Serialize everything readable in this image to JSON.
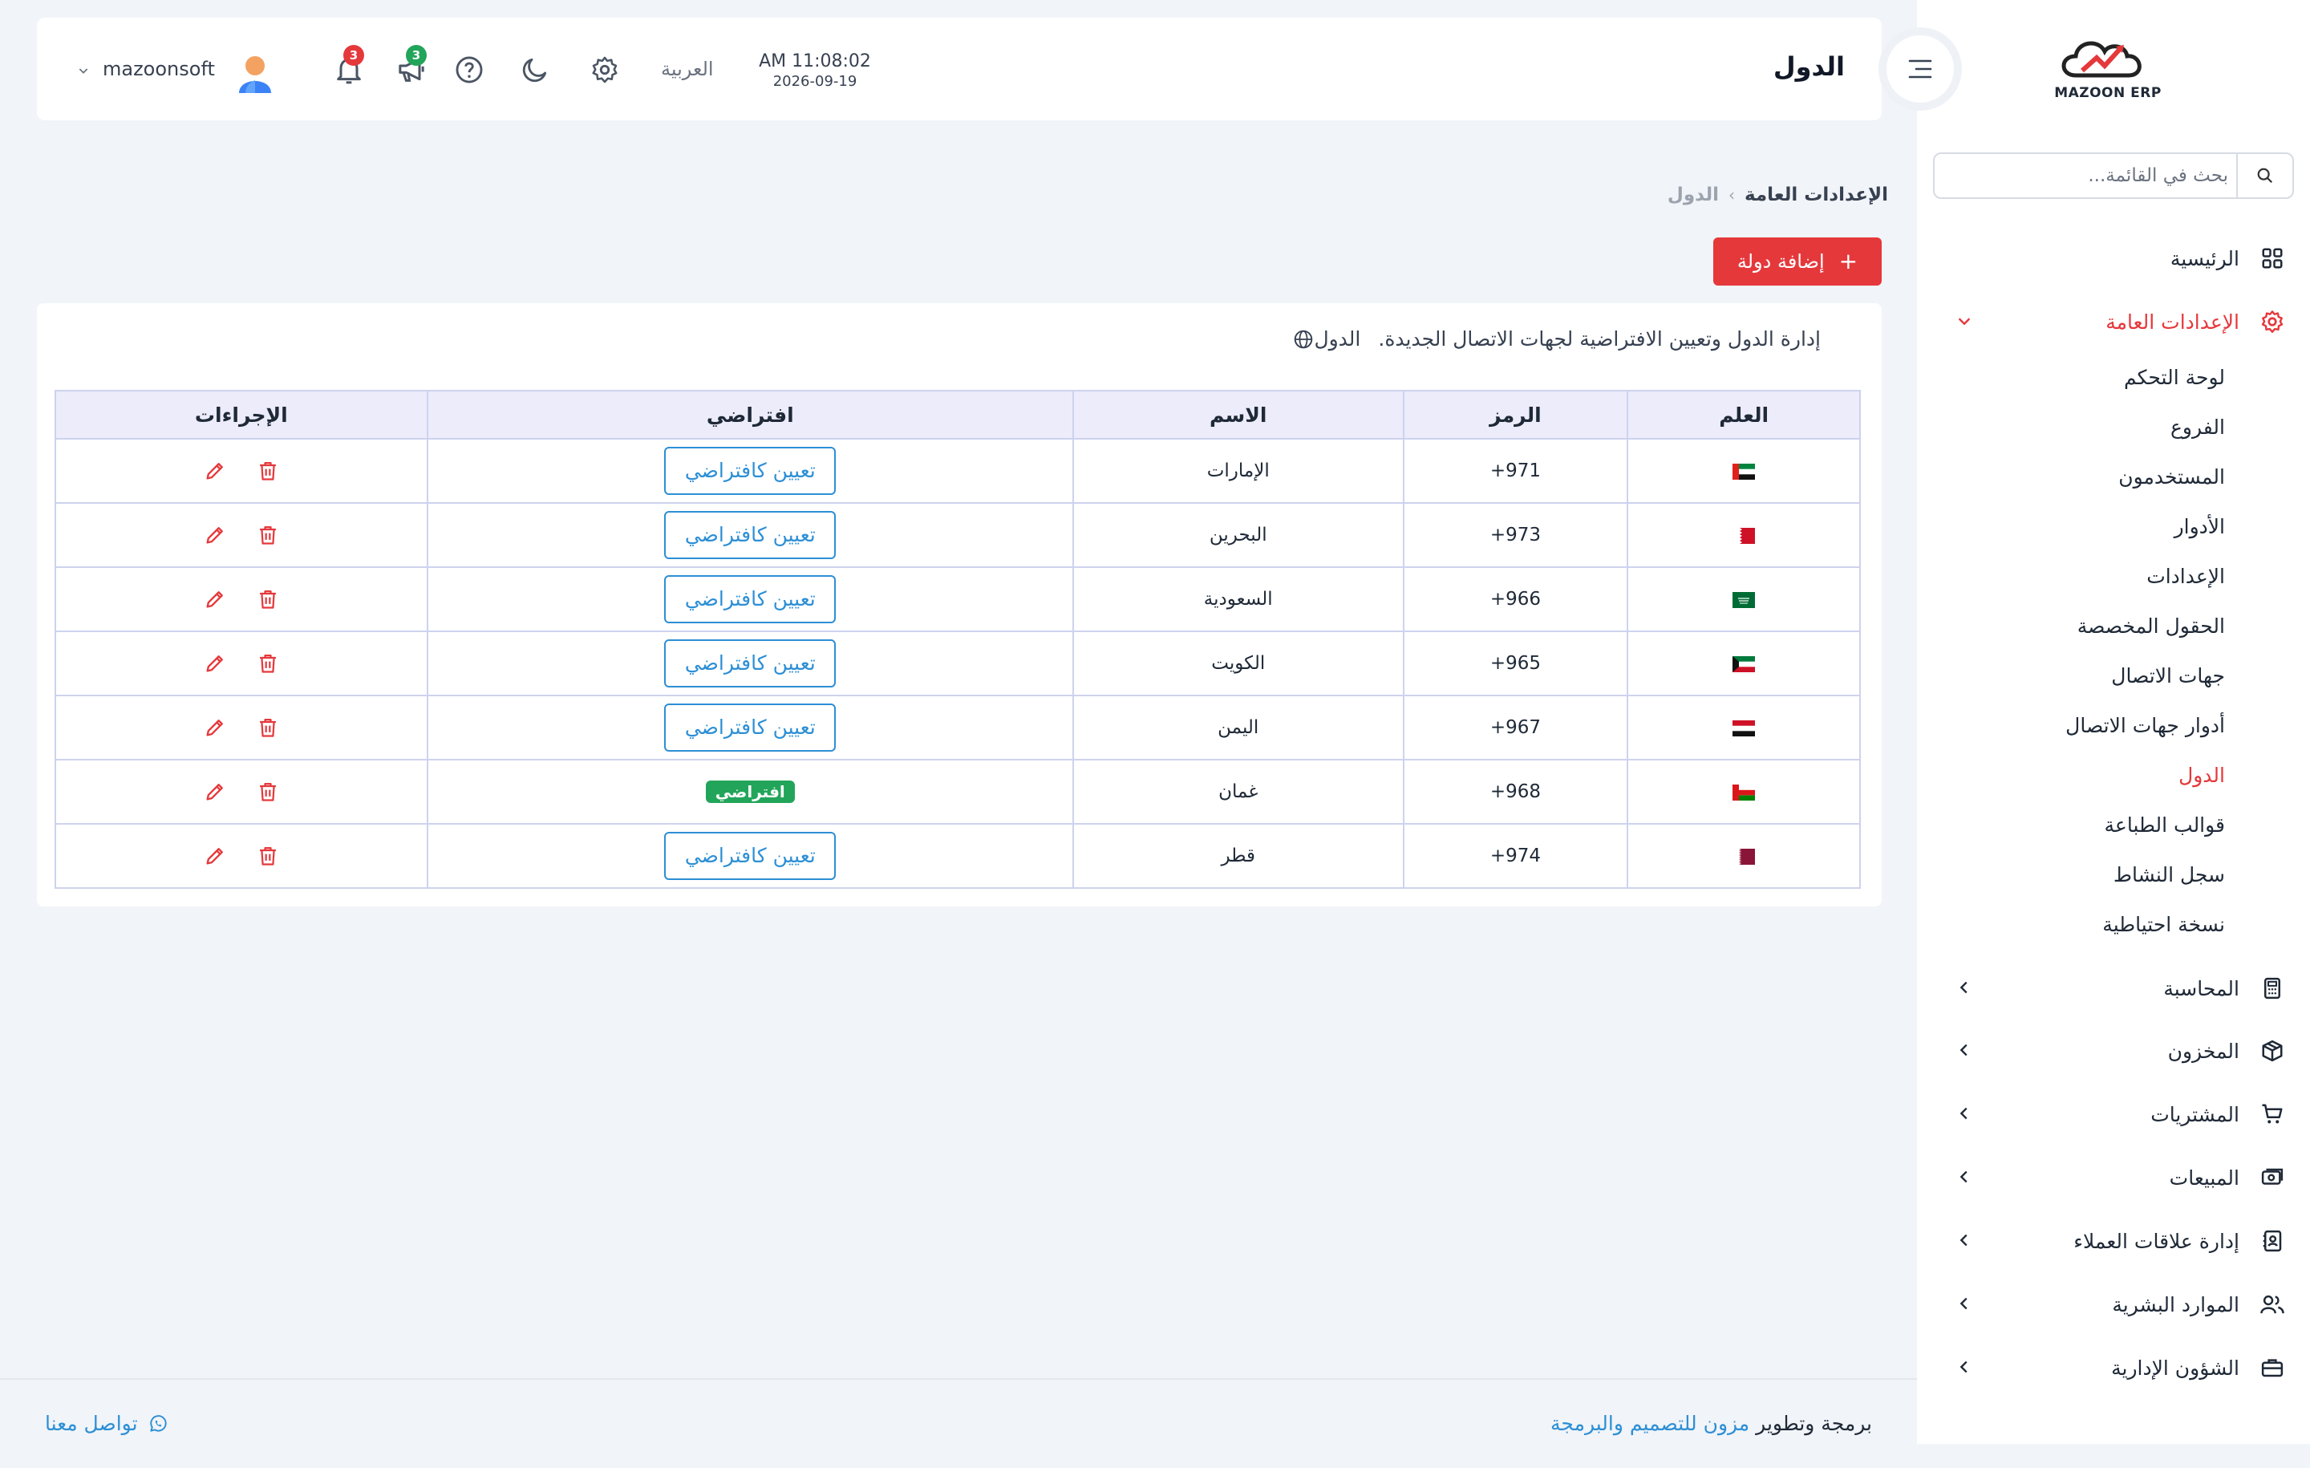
{
  "header": {
    "page_title": "الدول",
    "time": "AM 11:08:02",
    "date": "2026-09-19",
    "language": "العربية",
    "notifications_count": "3",
    "announcements_count": "3",
    "user_name": "mazoonsoft"
  },
  "sidebar": {
    "logo_text": "MAZOON ERP",
    "search_placeholder": "بحث في القائمة...",
    "items": [
      {
        "label": "الرئيسية",
        "icon": "grid-icon"
      },
      {
        "label": "الإعدادات العامة",
        "icon": "gear-icon",
        "expanded": true
      },
      {
        "label": "المحاسبة",
        "icon": "calculator-icon"
      },
      {
        "label": "المخزون",
        "icon": "box-icon"
      },
      {
        "label": "المشتريات",
        "icon": "cart-icon"
      },
      {
        "label": "المبيعات",
        "icon": "cash-icon"
      },
      {
        "label": "إدارة علاقات العملاء",
        "icon": "contacts-icon"
      },
      {
        "label": "الموارد البشرية",
        "icon": "users-icon"
      },
      {
        "label": "الشؤون الإدارية",
        "icon": "briefcase-icon"
      }
    ],
    "sub_items": [
      "لوحة التحكم",
      "الفروع",
      "المستخدمون",
      "الأدوار",
      "الإعدادات",
      "الحقول المخصصة",
      "جهات الاتصال",
      "أدوار جهات الاتصال",
      "الدول",
      "قوالب الطباعة",
      "سجل النشاط",
      "نسخة احتياطية"
    ]
  },
  "breadcrumb": {
    "root": "الإعدادات العامة",
    "current": "الدول"
  },
  "add_button_label": "إضافة دولة",
  "card": {
    "title": "الدول",
    "description": "إدارة الدول وتعيين الافتراضية لجهات الاتصال الجديدة."
  },
  "table": {
    "headers": [
      "العلم",
      "الرمز",
      "الاسم",
      "افتراضي",
      "الإجراءات"
    ],
    "set_default_label": "تعيين كافتراضي",
    "default_badge": "افتراضي",
    "rows": [
      {
        "flag": "uae",
        "code": "+971",
        "name": "الإمارات",
        "is_default": false
      },
      {
        "flag": "bahrain",
        "code": "+973",
        "name": "البحرين",
        "is_default": false
      },
      {
        "flag": "saudi",
        "code": "+966",
        "name": "السعودية",
        "is_default": false
      },
      {
        "flag": "kuwait",
        "code": "+965",
        "name": "الكويت",
        "is_default": false
      },
      {
        "flag": "yemen",
        "code": "+967",
        "name": "اليمن",
        "is_default": false
      },
      {
        "flag": "oman",
        "code": "+968",
        "name": "غمان",
        "is_default": true
      },
      {
        "flag": "qatar",
        "code": "+974",
        "name": "قطر",
        "is_default": false
      }
    ]
  },
  "footer": {
    "credit_prefix": "برمجة وتطوير",
    "credit_link": "مزون للتصميم والبرمجة",
    "contact": "تواصل معنا"
  },
  "colors": {
    "accent": "#e5383b",
    "link": "#2d8fd5",
    "success": "#22a55a"
  }
}
